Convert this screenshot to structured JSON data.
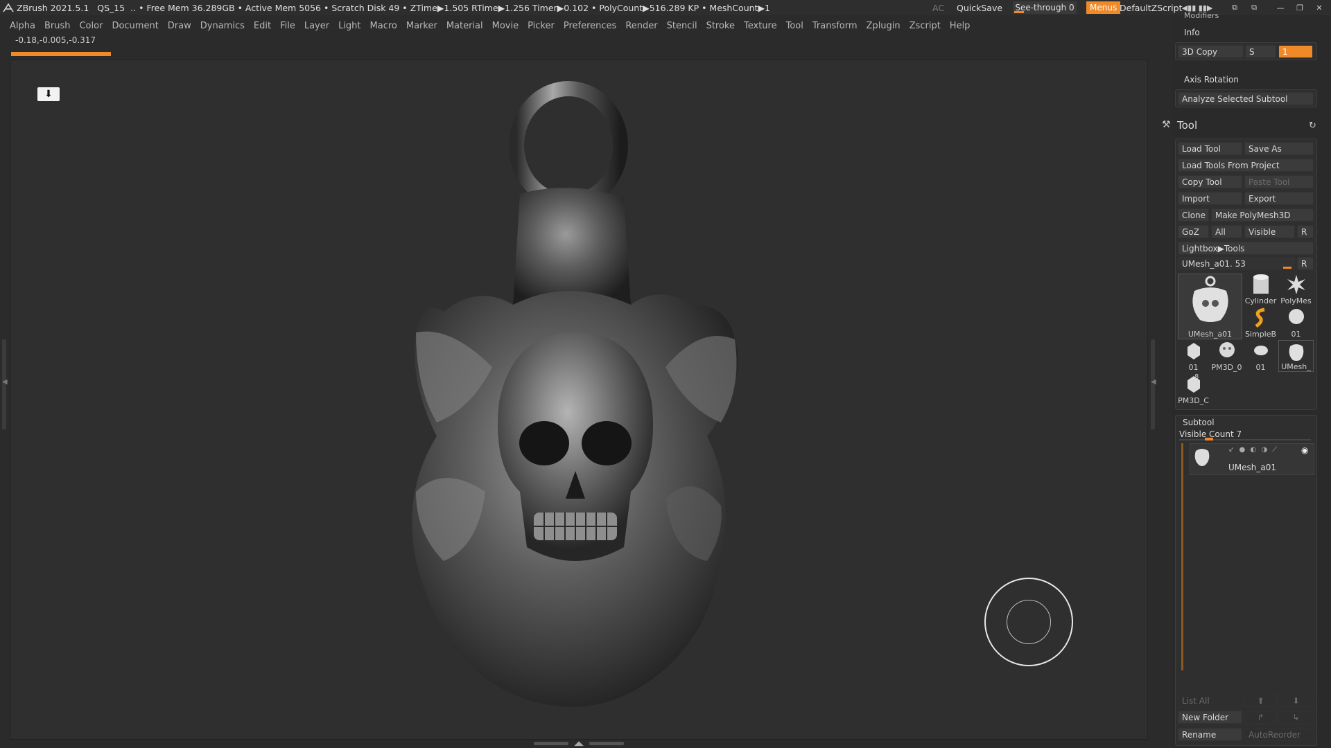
{
  "titlebar": {
    "app": "ZBrush 2021.5.1",
    "doc": "QS_15",
    "stats": ".. • Free Mem 36.289GB • Active Mem 5056 • Scratch Disk 49 •  ZTime▶1.505 RTime▶1.256 Timer▶0.102 • PolyCount▶516.289 KP  • MeshCount▶1",
    "ac": "AC",
    "quicksave": "QuickSave",
    "seethrough": "See-through  0",
    "menus": "Menus",
    "default_script": "DefaultZScript"
  },
  "menubar": [
    "Alpha",
    "Brush",
    "Color",
    "Document",
    "Draw",
    "Dynamics",
    "Edit",
    "File",
    "Layer",
    "Light",
    "Macro",
    "Marker",
    "Material",
    "Movie",
    "Picker",
    "Preferences",
    "Render",
    "Stencil",
    "Stroke",
    "Texture",
    "Tool",
    "Transform",
    "Zplugin",
    "Zscript",
    "Help"
  ],
  "coords": "-0.18,-0.005,-0.317",
  "progress_fraction": 0.09,
  "panel": {
    "modifiers": "Modifiers",
    "info": "Info",
    "copy3d": "3D Copy",
    "s_label": "S",
    "s_value": "1",
    "axis_rotation": "Axis Rotation",
    "analyze": "Analyze Selected Subtool",
    "tool_title": "Tool",
    "load_tool": "Load Tool",
    "save_as": "Save As",
    "load_tools_project": "Load Tools From Project",
    "copy_tool": "Copy Tool",
    "paste_tool": "Paste Tool",
    "import": "Import",
    "export": "Export",
    "clone": "Clone",
    "make_polymesh": "Make PolyMesh3D",
    "goz": "GoZ",
    "all": "All",
    "visible": "Visible",
    "r": "R",
    "lightbox_tools": "Lightbox▶Tools",
    "current_tool": "UMesh_a01. 53",
    "thumbs": {
      "main": "UMesh_a01",
      "cylinder": "Cylinder",
      "polymesh": "PolyMes",
      "simpleb": "SimpleB",
      "t01a": "01",
      "t01b": "01",
      "pm3d0": "PM3D_0",
      "t01c": "01",
      "umesh": "UMesh_",
      "pm3dc": "PM3D_C",
      "badge": "8"
    },
    "subtool_title": "Subtool",
    "visible_count": "Visible Count 7",
    "subtool_item": "UMesh_a01",
    "list_all": "List All",
    "new_folder": "New Folder",
    "rename": "Rename",
    "autoreorder": "AutoReorder"
  }
}
